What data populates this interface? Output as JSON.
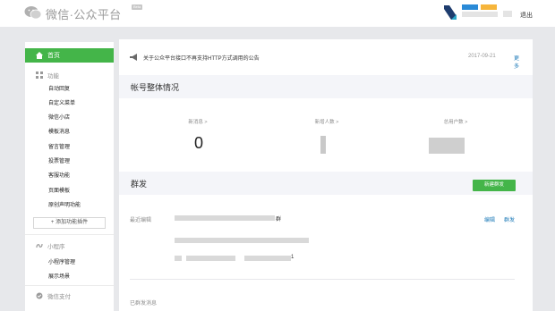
{
  "header": {
    "logo_text": "微信·公众平台",
    "beta_label": "Beta",
    "logout_label": "退出",
    "brand_color": "#44b549"
  },
  "sidebar": {
    "home_label": "首页",
    "function_label": "功能",
    "function_items": [
      "自动回复",
      "自定义菜单",
      "微信小店",
      "模板消息",
      "留言管理",
      "投票管理",
      "客服功能",
      "页面模板",
      "原创声明功能"
    ],
    "add_plugin_label": "+ 添加功能插件",
    "miniprogram_label": "小程序",
    "miniprogram_items": [
      "小程序管理",
      "展示场景"
    ],
    "wxpay_label": "微信支付"
  },
  "notice": {
    "text": "关于公众平台接口不再支持HTTP方式调用的公告",
    "date": "2017-09-21",
    "more_label": "更多"
  },
  "overview": {
    "title": "帐号整体情况",
    "stats": [
      {
        "label": "新消息 >",
        "value": "0"
      },
      {
        "label": "新增人数 >",
        "value": ""
      },
      {
        "label": "总用户数 >",
        "value": ""
      }
    ]
  },
  "broadcast": {
    "title": "群发",
    "new_button_label": "新建群发",
    "recent_label": "最近编辑",
    "recent_suffix": "群",
    "recent_suffix2": "1",
    "edit_label": "编辑",
    "send_label": "群发",
    "sent_label": "已群发消息"
  }
}
